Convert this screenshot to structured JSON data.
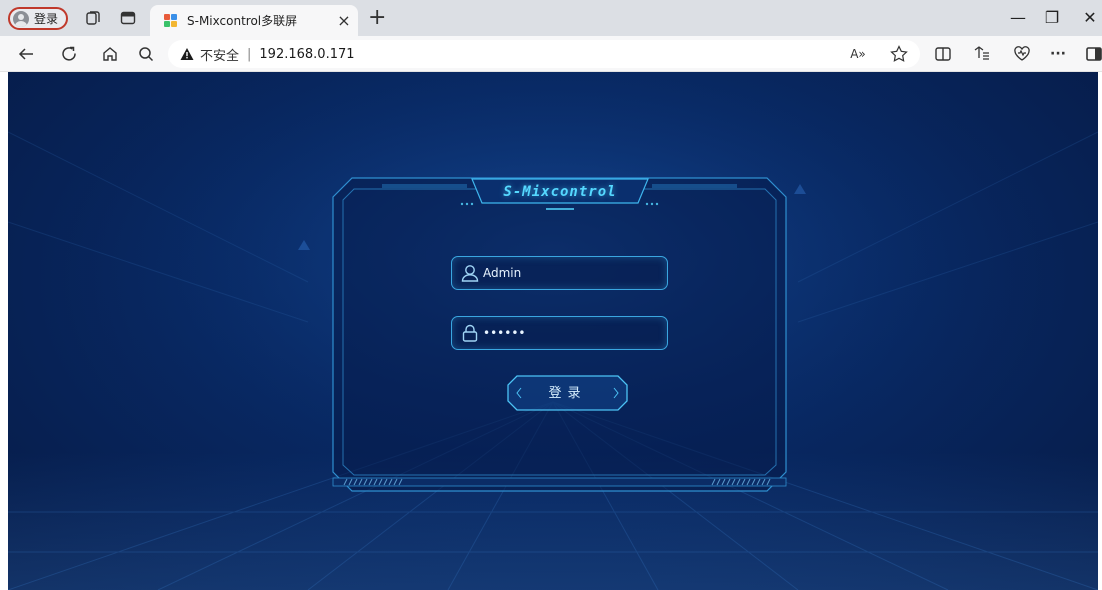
{
  "browser": {
    "profile_label": "登录",
    "tab_title": "S-Mixcontrol多联屏",
    "tab_close": "×",
    "new_tab": "+",
    "security_label": "不安全",
    "address_separator": "|",
    "url": "192.168.0.171",
    "window_controls": {
      "minimize": "—",
      "restore": "❐",
      "close": "✕"
    },
    "more_label": "···",
    "read_aloud_label": "A»",
    "icons": [
      "back-arrow-icon",
      "refresh-icon",
      "home-icon",
      "search-icon",
      "warning-icon",
      "favorites-star-icon",
      "split-screen-icon",
      "collections-icon",
      "browser-essentials-icon",
      "more-icon",
      "sidebar-icon"
    ]
  },
  "login": {
    "title": "S-Mixcontrol",
    "username_value": "Admin",
    "password_value": "••••••",
    "login_label": "登录"
  },
  "colors": {
    "accent": "#55d8ff",
    "frame": "#3aa6e0",
    "background": "#082862",
    "warning": "#1a1a1a",
    "profile_border": "#c0392b"
  }
}
